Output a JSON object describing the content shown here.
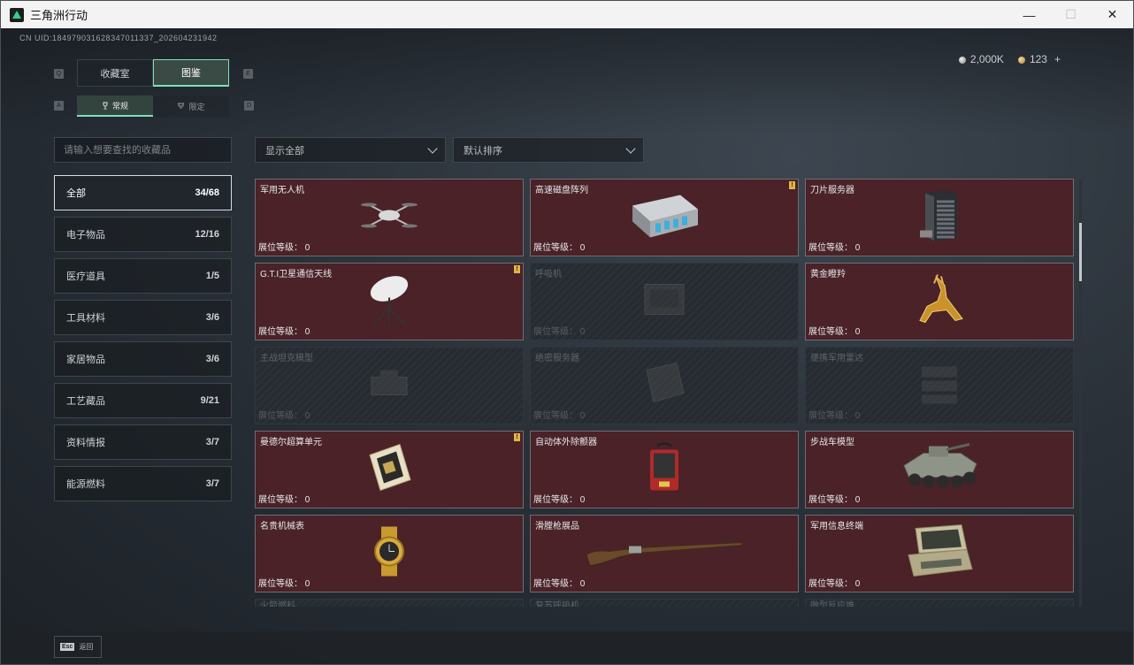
{
  "window": {
    "title": "三角洲行动",
    "minimize": "—",
    "maximize": "☐",
    "close": "✕"
  },
  "uid": "CN UID:1849790316283470113​37_202604231942",
  "currency": {
    "silver": "2,000K",
    "gold": "123",
    "plus": "+"
  },
  "keys": {
    "top_left": "Q",
    "top_right": "E",
    "sub_left": "A",
    "sub_right": "D"
  },
  "top_tabs": [
    {
      "label": "收藏室"
    },
    {
      "label": "图鉴"
    }
  ],
  "sub_tabs": [
    {
      "label": "常规",
      "icon": "trophy-icon"
    },
    {
      "label": "限定",
      "icon": "cup-icon"
    }
  ],
  "search": {
    "placeholder": "请输入想要查找的收藏品"
  },
  "filters": {
    "show": "显示全部",
    "sort": "默认排序"
  },
  "categories": [
    {
      "label": "全部",
      "count": "34/68"
    },
    {
      "label": "电子物品",
      "count": "12/16"
    },
    {
      "label": "医疗道具",
      "count": "1/5"
    },
    {
      "label": "工具材料",
      "count": "3/6"
    },
    {
      "label": "家居物品",
      "count": "3/6"
    },
    {
      "label": "工艺藏品",
      "count": "9/21"
    },
    {
      "label": "资料情报",
      "count": "3/7"
    },
    {
      "label": "能源燃料",
      "count": "3/7"
    }
  ],
  "level_label": "展位等级：",
  "items": [
    {
      "name": "军用无人机",
      "level": "0",
      "state": "owned",
      "badge": "",
      "icon": "drone-icon"
    },
    {
      "name": "高速磁盘阵列",
      "level": "0",
      "state": "owned",
      "badge": "!",
      "icon": "disk-array-icon"
    },
    {
      "name": "刀片服务器",
      "level": "0",
      "state": "owned",
      "badge": "",
      "icon": "blade-server-icon"
    },
    {
      "name": "G.T.I卫星通信天线",
      "level": "0",
      "state": "owned",
      "badge": "!",
      "icon": "satellite-dish-icon"
    },
    {
      "name": "呼吸机",
      "level": "0",
      "state": "locked",
      "badge": "",
      "icon": "ventilator-icon"
    },
    {
      "name": "黄金瞪羚",
      "level": "0",
      "state": "owned",
      "badge": "",
      "icon": "golden-gazelle-icon"
    },
    {
      "name": "主战坦克模型",
      "level": "0",
      "state": "locked",
      "badge": "",
      "icon": "tank-model-icon"
    },
    {
      "name": "绝密服务器",
      "level": "0",
      "state": "locked",
      "badge": "",
      "icon": "secret-server-icon"
    },
    {
      "name": "便携军用雷达",
      "level": "0",
      "state": "locked",
      "badge": "",
      "icon": "radar-icon"
    },
    {
      "name": "曼德尔超算单元",
      "level": "0",
      "state": "owned",
      "badge": "!",
      "icon": "supercompute-unit-icon"
    },
    {
      "name": "自动体外除颤器",
      "level": "0",
      "state": "owned",
      "badge": "",
      "icon": "defibrillator-icon"
    },
    {
      "name": "步战车模型",
      "level": "0",
      "state": "owned",
      "badge": "",
      "icon": "ifv-model-icon"
    },
    {
      "name": "名贵机械表",
      "level": "0",
      "state": "owned",
      "badge": "",
      "icon": "gold-watch-icon"
    },
    {
      "name": "滑膛枪展品",
      "level": "0",
      "state": "owned",
      "badge": "",
      "icon": "musket-icon"
    },
    {
      "name": "军用信息终端",
      "level": "0",
      "state": "owned",
      "badge": "",
      "icon": "info-terminal-icon"
    }
  ],
  "partial_items": [
    {
      "name": "火箭燃料"
    },
    {
      "name": "复苏呼吸机"
    },
    {
      "name": "微型反应堆"
    }
  ],
  "footer": {
    "esc_key": "Esc",
    "esc_label": "返回"
  }
}
